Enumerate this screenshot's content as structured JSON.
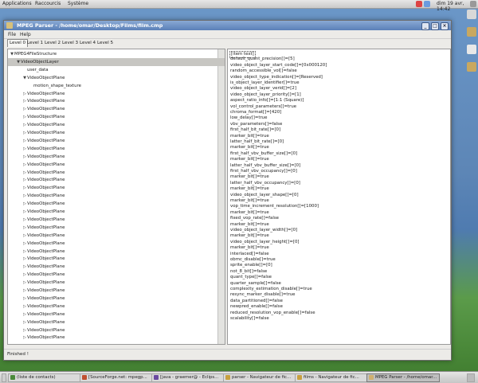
{
  "top_panel": {
    "menus": [
      "Applications",
      "Raccourcis",
      "Système"
    ],
    "clock": "dim 19 avr, 14:42"
  },
  "window": {
    "title": "MPEG Parser - /home/omar/Desktop/Films/film.cmp",
    "menu": [
      "File",
      "Help"
    ],
    "buttons": {
      "minimize": "_",
      "maximize": "□",
      "close": "×"
    },
    "tabs": [
      "Level 0",
      "Level 1",
      "Level 2",
      "Level 3",
      "Level 4",
      "Level 5"
    ],
    "active_tab": "Level 0",
    "tree": [
      {
        "text": "MPEG4FileStructure",
        "indent": 0,
        "toggle": "open"
      },
      {
        "text": "VideoObjectLayer",
        "indent": 1,
        "toggle": "open",
        "selected": true
      },
      {
        "text": "user_data",
        "indent": 2,
        "toggle": "none"
      },
      {
        "text": "VideoObjectPlane",
        "indent": 2,
        "toggle": "open"
      },
      {
        "text": "motion_shape_texture",
        "indent": 3,
        "toggle": "none"
      },
      {
        "text": "VideoObjectPlane",
        "indent": 2,
        "toggle": "closed"
      },
      {
        "text": "VideoObjectPlane",
        "indent": 2,
        "toggle": "closed"
      },
      {
        "text": "VideoObjectPlane",
        "indent": 2,
        "toggle": "closed"
      },
      {
        "text": "VideoObjectPlane",
        "indent": 2,
        "toggle": "closed"
      },
      {
        "text": "VideoObjectPlane",
        "indent": 2,
        "toggle": "closed"
      },
      {
        "text": "VideoObjectPlane",
        "indent": 2,
        "toggle": "closed"
      },
      {
        "text": "VideoObjectPlane",
        "indent": 2,
        "toggle": "closed"
      },
      {
        "text": "VideoObjectPlane",
        "indent": 2,
        "toggle": "closed"
      },
      {
        "text": "VideoObjectPlane",
        "indent": 2,
        "toggle": "closed"
      },
      {
        "text": "VideoObjectPlane",
        "indent": 2,
        "toggle": "closed"
      },
      {
        "text": "VideoObjectPlane",
        "indent": 2,
        "toggle": "closed"
      },
      {
        "text": "VideoObjectPlane",
        "indent": 2,
        "toggle": "closed"
      },
      {
        "text": "VideoObjectPlane",
        "indent": 2,
        "toggle": "closed"
      },
      {
        "text": "VideoObjectPlane",
        "indent": 2,
        "toggle": "closed"
      },
      {
        "text": "VideoObjectPlane",
        "indent": 2,
        "toggle": "closed"
      },
      {
        "text": "VideoObjectPlane",
        "indent": 2,
        "toggle": "closed"
      },
      {
        "text": "VideoObjectPlane",
        "indent": 2,
        "toggle": "closed"
      },
      {
        "text": "VideoObjectPlane",
        "indent": 2,
        "toggle": "closed"
      },
      {
        "text": "VideoObjectPlane",
        "indent": 2,
        "toggle": "closed"
      },
      {
        "text": "VideoObjectPlane",
        "indent": 2,
        "toggle": "closed"
      },
      {
        "text": "VideoObjectPlane",
        "indent": 2,
        "toggle": "closed"
      },
      {
        "text": "VideoObjectPlane",
        "indent": 2,
        "toggle": "closed"
      },
      {
        "text": "VideoObjectPlane",
        "indent": 2,
        "toggle": "closed"
      },
      {
        "text": "VideoObjectPlane",
        "indent": 2,
        "toggle": "closed"
      },
      {
        "text": "VideoObjectPlane",
        "indent": 2,
        "toggle": "closed"
      },
      {
        "text": "VideoObjectPlane",
        "indent": 2,
        "toggle": "closed"
      },
      {
        "text": "VideoObjectPlane",
        "indent": 2,
        "toggle": "closed"
      },
      {
        "text": "VideoObjectPlane",
        "indent": 2,
        "toggle": "closed"
      },
      {
        "text": "VideoObjectPlane",
        "indent": 2,
        "toggle": "closed"
      },
      {
        "text": "VideoObjectPlane",
        "indent": 2,
        "toggle": "closed"
      },
      {
        "text": "VideoObjectPlane",
        "indent": 2,
        "toggle": "closed"
      },
      {
        "text": "VideoObjectPlane",
        "indent": 2,
        "toggle": "closed"
      }
    ],
    "details": [
      "[item text]",
      "default_quant_precision[]=[5]",
      "video_object_layer_start_code[]=[0x000120]",
      "random_accessible_vol[]=false",
      "video_object_type_indication[]=[Reserved]",
      "is_object_layer_identifier[]=true",
      "video_object_layer_verid[]=[2]",
      "video_object_layer_priority[]=[1]",
      "aspect_ratio_info[]=[1:1 (Square)]",
      "vol_control_parameters[]=true",
      "chroma_format[]=[420]",
      "low_delay[]=true",
      "vbv_parameters[]=false",
      "first_half_bit_rate[]=[0]",
      "marker_bit[]=true",
      "latter_half_bit_rate[]=[0]",
      "marker_bit[]=true",
      "first_half_vbv_buffer_size[]=[0]",
      "marker_bit[]=true",
      "latter_half_vbv_buffer_size[]=[0]",
      "first_half_vbv_occupancy[]=[0]",
      "marker_bit[]=true",
      "latter_half_vbv_occupancy[]=[0]",
      "marker_bit[]=true",
      "video_object_layer_shape[]=[0]",
      "marker_bit[]=true",
      "vop_time_increment_resolution[]=[1000]",
      "marker_bit[]=true",
      "fixed_vop_rate[]=false",
      "marker_bit[]=true",
      "video_object_layer_width[]=[0]",
      "marker_bit[]=true",
      "video_object_layer_height[]=[0]",
      "marker_bit[]=true",
      "interlaced[]=false",
      "obmc_disable[]=true",
      "sprite_enable[]=[0]",
      "not_8_bit[]=false",
      "quant_type[]=false",
      "quarter_sample[]=false",
      "complexity_estimation_disable[]=true",
      "resync_marker_disable[]=true",
      "data_partitioned[]=false",
      "newpred_enable[]=false",
      "reduced_resolution_vop_enable[]=false",
      "scalability[]=false"
    ],
    "status": "Finished !"
  },
  "taskbar": {
    "items": [
      {
        "label": "(liste de contacts)",
        "active": false,
        "color": "#4a8a3a"
      },
      {
        "label": "[SourceForge.net: mpegp...",
        "active": false,
        "color": "#c05030"
      },
      {
        "label": "[java - graemer@ - Eclips...",
        "active": false,
        "color": "#6a4aa0"
      },
      {
        "label": "parser - Navigateur de fic...",
        "active": false,
        "color": "#c8a040"
      },
      {
        "label": "films - Navigateur de fic...",
        "active": false,
        "color": "#c8a040"
      },
      {
        "label": "MPEG Parser - /home/omar...",
        "active": true,
        "color": "#d0b070"
      }
    ]
  }
}
